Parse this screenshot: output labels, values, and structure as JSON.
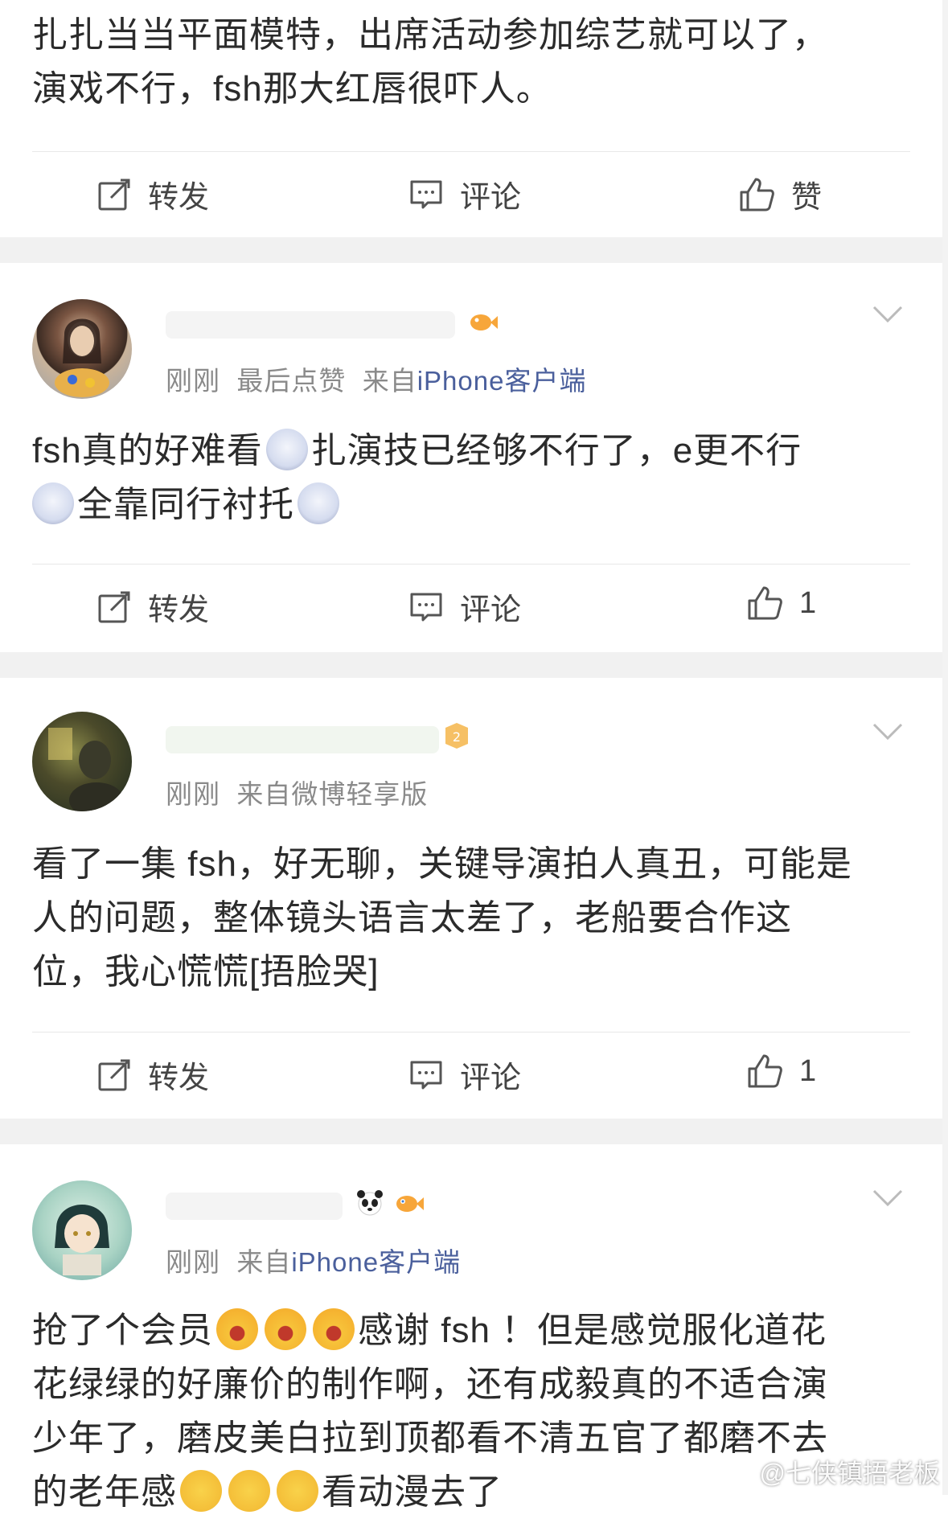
{
  "post0": {
    "text_line1": "扎扎当当平面模特，出席活动参加综艺就可以了，",
    "text_line2": "演戏不行，fsh那大红唇很吓人。",
    "repost_label": "转发",
    "comment_label": "评论",
    "like_label": "赞"
  },
  "post1": {
    "time": "刚刚",
    "extra": "最后点赞",
    "source_prefix": "来自",
    "client": "iPhone客户端",
    "text_part1": "fsh真的好难看",
    "text_part2": "扎演技已经够不行了，e更不行",
    "text_part3": "全靠同行衬托",
    "repost_label": "转发",
    "comment_label": "评论",
    "like_count": "1"
  },
  "post2": {
    "time": "刚刚",
    "source_prefix": "来自",
    "client": "微博轻享版",
    "text_line1": "看了一集 fsh，好无聊，关键导演拍人真丑，可能是",
    "text_line2": "人的问题，整体镜头语言太差了，老船要合作这",
    "text_line3": "位，我心慌慌[捂脸哭]",
    "repost_label": "转发",
    "comment_label": "评论",
    "like_count": "1"
  },
  "post3": {
    "time": "刚刚",
    "source_prefix": "来自",
    "client": "iPhone客户端",
    "text_part1": "抢了个会员",
    "text_part2": "感谢 fsh ！但是感觉服化道花",
    "text_line2": "花绿绿的好廉价的制作啊，还有成毅真的不适合演",
    "text_line3": "少年了，磨皮美白拉到顶都看不清五官了都磨不去",
    "text_part4": "的老年感",
    "text_part5": "看动漫去了"
  },
  "watermark": "@七侠镇捂老板",
  "colors": {
    "accent_blue": "#4a5f9c",
    "meta_gray": "#8a8a8a",
    "separator": "#f1f1f1"
  },
  "icons": [
    "repost-icon",
    "comment-icon",
    "like-icon",
    "chevron-down-icon",
    "weibo-logo-icon"
  ]
}
